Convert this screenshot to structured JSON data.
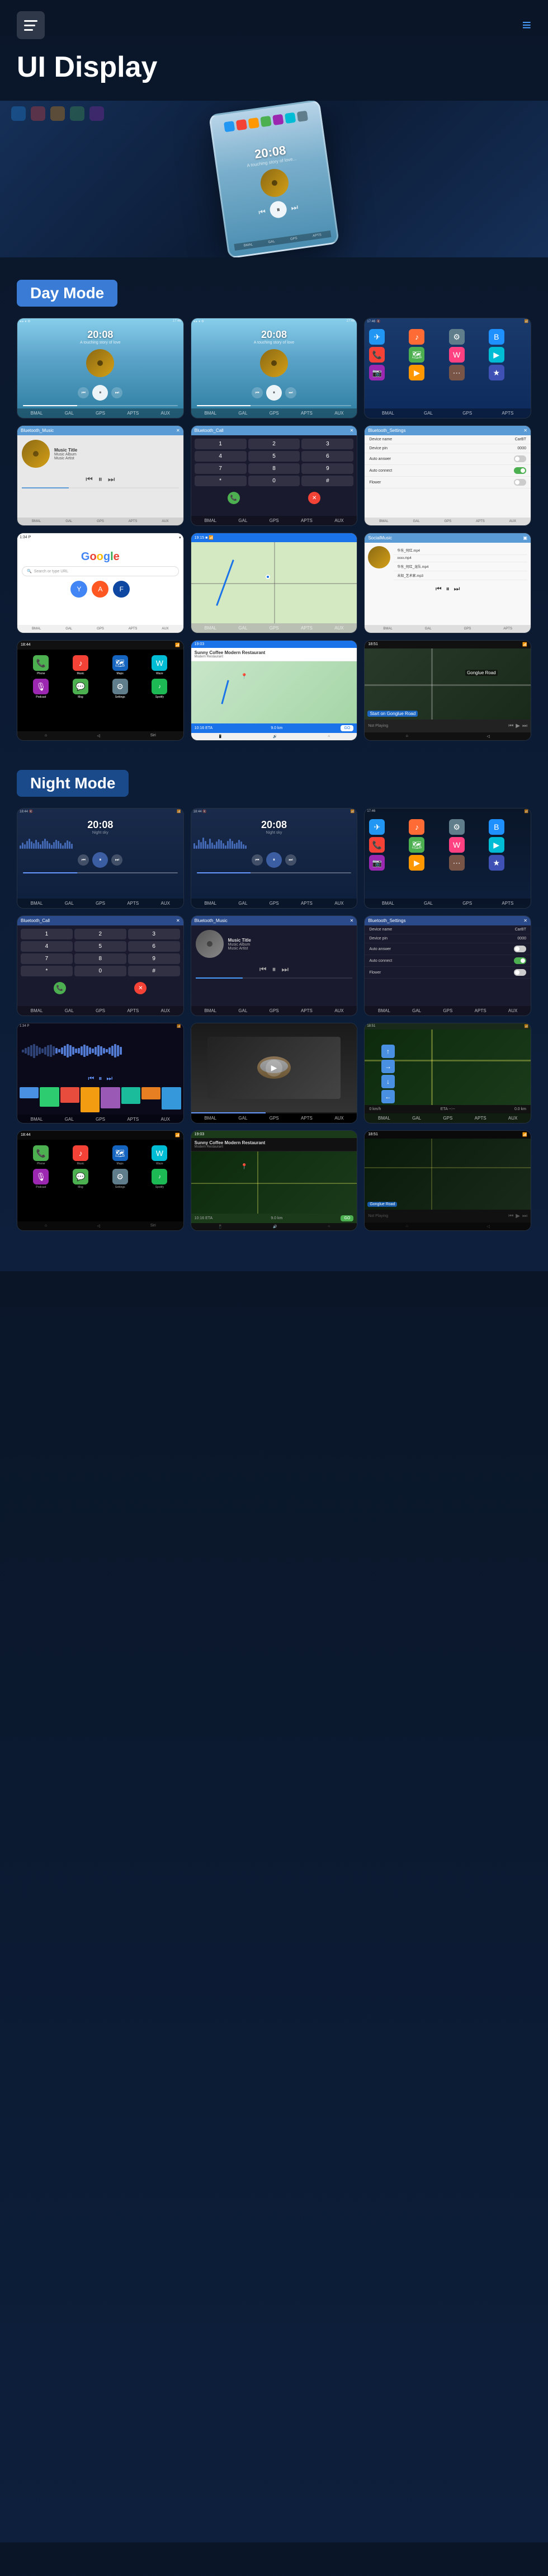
{
  "header": {
    "title": "UI Display",
    "menu_icon": "☰",
    "dots_icon": "⋮"
  },
  "hero": {
    "time": "20:08",
    "subtitle": "A touching story of love..."
  },
  "modes": {
    "day": {
      "label": "Day Mode",
      "screens": [
        {
          "type": "music",
          "time": "20:08",
          "subtitle": "A touching story of love"
        },
        {
          "type": "music",
          "time": "20:08",
          "subtitle": "A touching story of love"
        },
        {
          "type": "app_grid",
          "label": "App Grid"
        },
        {
          "type": "bluetooth_music",
          "title": "Bluetooth_Music",
          "track": "Music Title",
          "album": "Music Album",
          "artist": "Music Artist"
        },
        {
          "type": "bluetooth_call",
          "title": "Bluetooth_Call"
        },
        {
          "type": "bluetooth_settings",
          "title": "Bluetooth_Settings",
          "device_name": "CarBT",
          "device_pin": "0000",
          "auto_answer": "Off",
          "auto_connect": "On",
          "flower": "Off"
        },
        {
          "type": "google",
          "label": "Google"
        },
        {
          "type": "map",
          "label": "Navigation Map"
        },
        {
          "type": "local_music",
          "title": "SocialMusic",
          "tracks": [
            "华东_何红.mp4",
            "xxxx.mp4",
            "华东_何红_龙队.mp4",
            "未知_艺术家.mp3"
          ]
        },
        {
          "type": "carplay_home",
          "label": "CarPlay Home"
        },
        {
          "type": "carplay_nav",
          "label": "CarPlay Navigation",
          "destination": "Sunny Coffee Modern Restaurant",
          "eta": "10:16 ETA",
          "distance": "9.0 km"
        },
        {
          "type": "carplay_music",
          "label": "CarPlay Music",
          "status": "Not Playing",
          "road": "Gonglue Road"
        }
      ]
    },
    "night": {
      "label": "Night Mode",
      "screens": [
        {
          "type": "music_night",
          "time": "20:08",
          "subtitle": "Night sky background"
        },
        {
          "type": "music_night",
          "time": "20:08",
          "subtitle": "Night sky background"
        },
        {
          "type": "app_grid_night",
          "label": "App Grid Night"
        },
        {
          "type": "bluetooth_call_night",
          "title": "Bluetooth_Call"
        },
        {
          "type": "bluetooth_music_night",
          "title": "Bluetooth_Music",
          "track": "Music Title",
          "album": "Music Album",
          "artist": "Music Artist"
        },
        {
          "type": "bluetooth_settings_night",
          "title": "Bluetooth_Settings",
          "device_name": "CarBT",
          "device_pin": "0000"
        },
        {
          "type": "waveform_night",
          "label": "Audio Waveform"
        },
        {
          "type": "video_night",
          "label": "Video Player"
        },
        {
          "type": "navigation_night",
          "label": "Night Navigation"
        },
        {
          "type": "carplay_home_night",
          "label": "CarPlay Home Night"
        },
        {
          "type": "carplay_nav_night",
          "label": "CarPlay Nav Night",
          "destination": "Sunny Coffee Modern Restaurant",
          "eta": "10:16 ETA",
          "distance": "9.0 km"
        },
        {
          "type": "carplay_music_night",
          "label": "CarPlay Music Night",
          "road": "Gonglue Road",
          "status": "Not Playing"
        }
      ]
    }
  },
  "bottom_nav": {
    "items": [
      "BMAL",
      "GAL",
      "GPS",
      "APTS",
      "AUX"
    ]
  },
  "wave_heights": [
    8,
    14,
    10,
    18,
    22,
    16,
    12,
    20,
    15,
    10,
    17,
    22,
    18,
    13,
    9,
    15,
    20,
    17,
    12,
    8,
    14,
    19,
    16,
    11
  ],
  "wave_heights_2": [
    12,
    8,
    20,
    15,
    25,
    18,
    10,
    22,
    14,
    9,
    16,
    21,
    19,
    13,
    7,
    18,
    23,
    17,
    11,
    14,
    20,
    16,
    10,
    8
  ]
}
